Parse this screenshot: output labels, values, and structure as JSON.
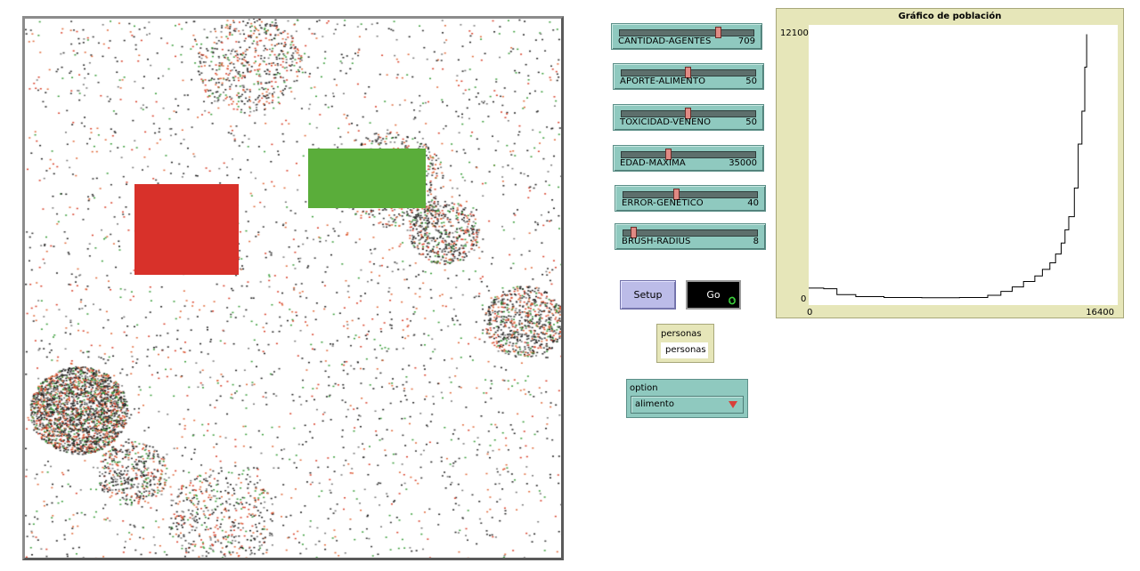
{
  "world": {
    "patches": [
      {
        "name": "red-patch",
        "color": "#d8312a"
      },
      {
        "name": "green-patch",
        "color": "#5aad3a"
      }
    ]
  },
  "sliders": [
    {
      "label": "CANTIDAD-AGENTES",
      "value": "709",
      "fraction": 0.74
    },
    {
      "label": "APORTE-ALIMENTO",
      "value": "50",
      "fraction": 0.5
    },
    {
      "label": "TOXICIDAD-VENENO",
      "value": "50",
      "fraction": 0.5
    },
    {
      "label": "EDAD-MAXIMA",
      "value": "35000",
      "fraction": 0.35
    },
    {
      "label": "ERROR-GENETICO",
      "value": "40",
      "fraction": 0.4
    },
    {
      "label": "BRUSH-RADIUS",
      "value": "8",
      "fraction": 0.08
    }
  ],
  "buttons": {
    "setup": "Setup",
    "go": "Go"
  },
  "monitor": {
    "label": "personas",
    "value": "personas"
  },
  "chooser": {
    "label": "option",
    "value": "alimento"
  },
  "plot": {
    "title": "Gráfico de población",
    "y_max": "12100",
    "y_min": "0",
    "x_min": "0",
    "x_max": "16400"
  },
  "chart_data": {
    "type": "line",
    "title": "Gráfico de población",
    "xlim": [
      0,
      16400
    ],
    "ylim": [
      0,
      12100
    ],
    "x": [
      0,
      800,
      1500,
      2500,
      4000,
      6000,
      8000,
      9500,
      10200,
      10800,
      11400,
      12000,
      12400,
      12800,
      13100,
      13400,
      13600,
      13800,
      14100,
      14300,
      14500,
      14650,
      14750
    ],
    "y": [
      450,
      420,
      150,
      60,
      20,
      10,
      20,
      120,
      300,
      500,
      750,
      1000,
      1300,
      1600,
      2000,
      2500,
      3100,
      3700,
      5000,
      7000,
      8500,
      10500,
      12000
    ]
  }
}
